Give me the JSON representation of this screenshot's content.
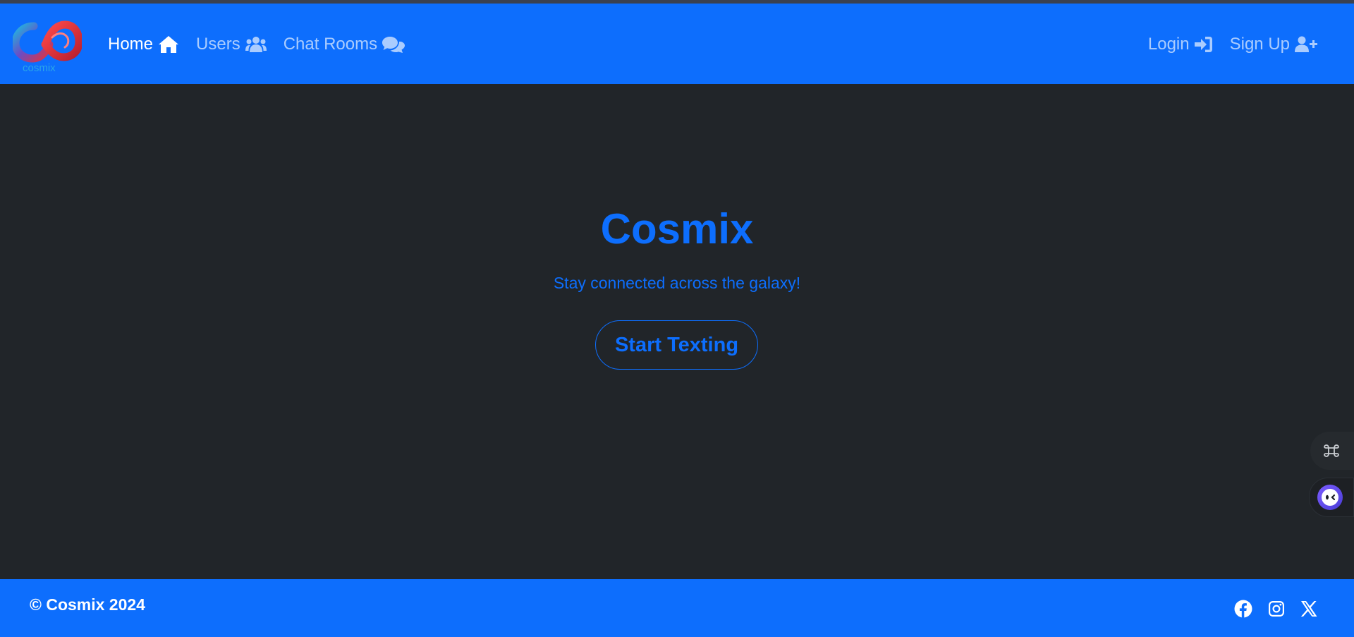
{
  "brand": {
    "logo_text": "cosmix"
  },
  "navbar": {
    "left_links": [
      {
        "label": "Home",
        "icon": "home-icon",
        "active": true
      },
      {
        "label": "Users",
        "icon": "users-icon",
        "active": false
      },
      {
        "label": "Chat Rooms",
        "icon": "comments-icon",
        "active": false
      }
    ],
    "right_links": [
      {
        "label": "Login",
        "icon": "sign-in-icon"
      },
      {
        "label": "Sign Up",
        "icon": "user-plus-icon"
      }
    ]
  },
  "hero": {
    "title": "Cosmix",
    "subtitle": "Stay connected across the galaxy!",
    "cta_label": "Start Texting"
  },
  "side_widgets": [
    {
      "icon": "command-icon"
    },
    {
      "icon": "ai-assistant-icon"
    }
  ],
  "footer": {
    "copyright": "© Cosmix 2024",
    "socials": [
      "facebook-icon",
      "instagram-icon",
      "x-icon"
    ]
  },
  "colors": {
    "primary": "#0d6efd",
    "background": "#212529",
    "nav_text_inactive": "rgba(255,255,255,0.65)",
    "white": "#ffffff"
  }
}
